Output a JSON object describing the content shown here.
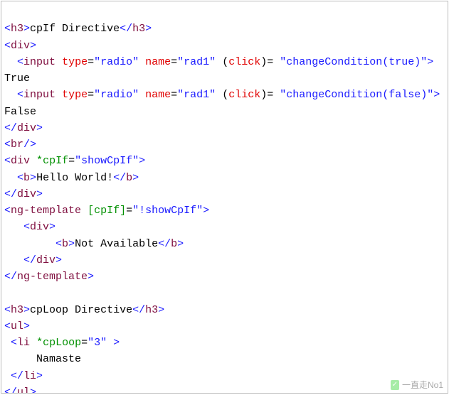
{
  "code": {
    "line1": {
      "tag": "h3",
      "text": "cpIf Directive"
    },
    "line2": {
      "tag": "div"
    },
    "line3": {
      "tag": "input",
      "type_attr": "type",
      "type_val": "\"radio\"",
      "name_attr": "name",
      "name_val": "\"rad1\"",
      "click_attr": "click",
      "click_val": "\"changeCondition(true)\""
    },
    "line4": {
      "text": "True"
    },
    "line5": {
      "tag": "input",
      "type_attr": "type",
      "type_val": "\"radio\"",
      "name_attr": "name",
      "name_val": "\"rad1\"",
      "click_attr": "click",
      "click_val": "\"changeCondition(false)\""
    },
    "line6": {
      "text": "False"
    },
    "line7": {
      "tag": "div"
    },
    "line8": {
      "tag": "br"
    },
    "line9": {
      "tag": "div",
      "dir_attr": "cpIf",
      "dir_val": "\"showCpIf\""
    },
    "line10": {
      "tag": "b",
      "text": "Hello World!"
    },
    "line11": {
      "tag": "div"
    },
    "line12": {
      "tag": "ng-template",
      "dir_attr": "cpIf",
      "dir_val": "\"!showCpIf\""
    },
    "line13": {
      "tag": "div"
    },
    "line14": {
      "tag": "b",
      "text": "Not Available"
    },
    "line15": {
      "tag": "div"
    },
    "line16": {
      "tag": "ng-template"
    },
    "line17": "",
    "line18": {
      "tag": "h3",
      "text": "cpLoop Directive"
    },
    "line19": {
      "tag": "ul"
    },
    "line20": {
      "tag": "li",
      "dir_attr": "cpLoop",
      "dir_val": "\"3\""
    },
    "line21": {
      "text": "Namaste"
    },
    "line22": {
      "tag": "li"
    },
    "line23": {
      "tag": "ul"
    }
  },
  "watermark": {
    "icon": "✓",
    "text": "一直走No1"
  }
}
